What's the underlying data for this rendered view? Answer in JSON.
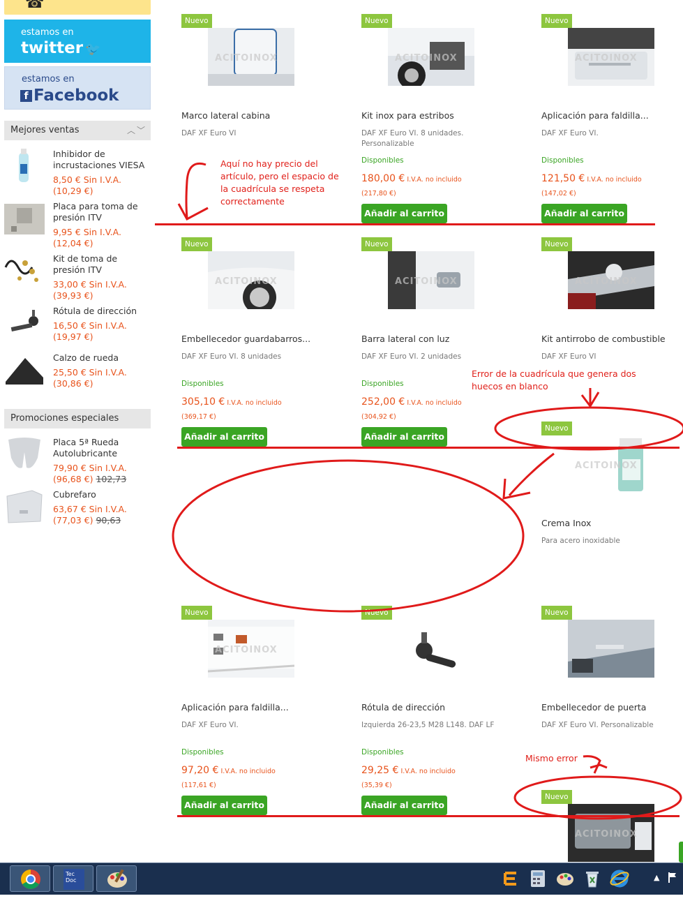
{
  "sidebar": {
    "twitter": {
      "small": "estamos en",
      "big": "twitter"
    },
    "facebook": {
      "small": "estamos en",
      "big": "Facebook",
      "f": "f"
    },
    "best_sellers": {
      "title": "Mejores ventas",
      "items": [
        {
          "name": "Inhibidor de incrustaciones VIESA",
          "price": "8,50 € Sin I.V.A.",
          "price_incl": "(10,29 €)"
        },
        {
          "name": "Placa para toma de presión ITV",
          "price": "9,95 € Sin I.V.A.",
          "price_incl": "(12,04 €)"
        },
        {
          "name": "Kit de toma de presión ITV",
          "price": "33,00 € Sin I.V.A.",
          "price_incl": "(39,93 €)"
        },
        {
          "name": "Rótula de dirección",
          "price": "16,50 € Sin I.V.A.",
          "price_incl": "(19,97 €)"
        },
        {
          "name": "Calzo de rueda",
          "price": "25,50 € Sin I.V.A.",
          "price_incl": "(30,86 €)"
        }
      ]
    },
    "promotions": {
      "title": "Promociones especiales",
      "items": [
        {
          "name": "Placa 5ª Rueda Autolubricante",
          "price": "79,90 € Sin I.V.A.",
          "price_incl": "(96,68 €)",
          "old_price": "102,73"
        },
        {
          "name": "Cubrefaro",
          "price": "63,67 € Sin I.V.A.",
          "price_incl": "(77,03 €)",
          "old_price": "90,63"
        }
      ]
    }
  },
  "products": [
    {
      "badge": "Nuevo",
      "title": "Marco lateral cabina",
      "desc": "DAF XF Euro VI",
      "watermark": "ACITOINOX"
    },
    {
      "badge": "Nuevo",
      "title": "Kit inox para estribos",
      "desc": "DAF XF Euro VI. 8 unidades. Personalizable",
      "avail": "Disponibles",
      "price": "180,00 €",
      "tax": "I.V.A. no incluido",
      "price_incl": "(217,80 €)",
      "button": "Añadir al carrito",
      "watermark": "ACITOINOX"
    },
    {
      "badge": "Nuevo",
      "title": "Aplicación para faldilla...",
      "desc": "DAF XF Euro VI.",
      "avail": "Disponibles",
      "price": "121,50 €",
      "tax": "I.V.A. no incluido",
      "price_incl": "(147,02 €)",
      "button": "Añadir al carrito",
      "watermark": "ACITOINOX"
    },
    {
      "badge": "Nuevo",
      "title": "Embellecedor guardabarros...",
      "desc": "DAF XF Euro VI. 8 unidades",
      "avail": "Disponibles",
      "price": "305,10 €",
      "tax": "I.V.A. no incluido",
      "price_incl": "(369,17 €)",
      "button": "Añadir al carrito",
      "watermark": "ACITOINOX"
    },
    {
      "badge": "Nuevo",
      "title": "Barra lateral con luz",
      "desc": "DAF XF Euro VI. 2 unidades",
      "avail": "Disponibles",
      "price": "252,00 €",
      "tax": "I.V.A. no incluido",
      "price_incl": "(304,92 €)",
      "button": "Añadir al carrito",
      "watermark": "ACITOINOX"
    },
    {
      "badge": "Nuevo",
      "title": "Kit antirrobo de combustible",
      "desc": "DAF XF Euro VI",
      "watermark": "ACITOINOX"
    },
    {
      "badge": "Nuevo",
      "title": "Crema Inox",
      "desc": "Para acero inoxidable",
      "watermark": "ACITOINOX"
    },
    {
      "badge": "Nuevo",
      "title": "Aplicación para faldilla...",
      "desc": "DAF XF Euro VI.",
      "avail": "Disponibles",
      "price": "97,20 €",
      "tax": "I.V.A. no incluido",
      "price_incl": "(117,61 €)",
      "button": "Añadir al carrito",
      "watermark": "ACITOINOX"
    },
    {
      "badge": "Nuevo",
      "title": "Rótula de dirección",
      "desc": "Izquierda 26-23,5 M28 L148. DAF LF",
      "avail": "Disponibles",
      "price": "29,25 €",
      "tax": "I.V.A. no incluido",
      "price_incl": "(35,39 €)",
      "button": "Añadir al carrito"
    },
    {
      "badge": "Nuevo",
      "title": "Embellecedor de puerta",
      "desc": "DAF XF Euro VI. Personalizable"
    },
    {
      "badge": "Nuevo",
      "watermark": "ACITOINOX"
    }
  ],
  "annotations": {
    "note1": "Aquí no hay precio del artículo, pero el espacio de la cuadrícula se respeta correctamente",
    "note2": "Error de la cuadrícula que genera dos huecos en blanco",
    "note3": "Mismo error"
  },
  "taskbar": {
    "items": [
      "chrome-icon",
      "tecdoc-icon",
      "paint-icon"
    ],
    "tecdoc_label": "Tec Doc"
  },
  "colors": {
    "accent_green": "#3aa524",
    "badge_green": "#8dc63f",
    "price_orange": "#e8531c",
    "annotation_red": "#e0201a"
  }
}
